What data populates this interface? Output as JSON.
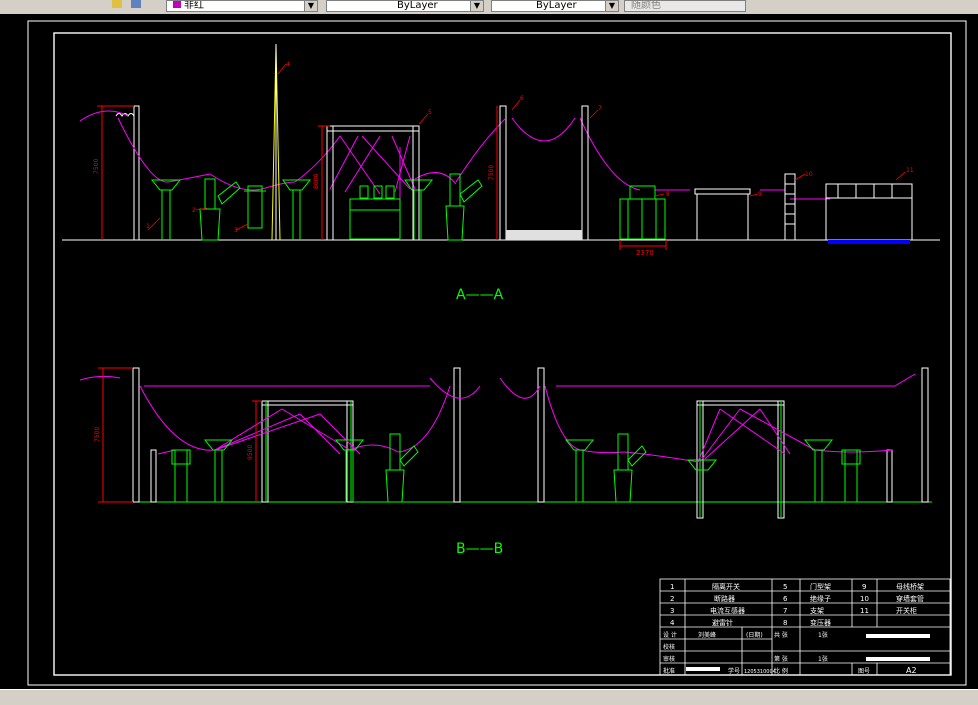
{
  "toolbar": {
    "layer_value": "非红",
    "linetype_value": "ByLayer",
    "lineweight_value": "ByLayer",
    "plotstyle_value": "随颜色"
  },
  "drawing": {
    "section_aa": "A——A",
    "section_bb": "B——B",
    "dims": {
      "aa_left_height": "7500",
      "aa_mid_height": "8000",
      "aa_right_height": "7500",
      "aa_bottom_width": "2370",
      "bb_left_height": "7500",
      "bb_mid_height": "9500"
    },
    "callouts": [
      "1",
      "2",
      "3",
      "4",
      "5",
      "6",
      "7",
      "8",
      "9",
      "10",
      "11"
    ]
  },
  "legend": {
    "rows": [
      {
        "n1": "1",
        "t1": "隔离开关",
        "n2": "5",
        "t2": "门型架",
        "n3": "9",
        "t3": "母线桥架"
      },
      {
        "n1": "2",
        "t1": "断路器",
        "n2": "6",
        "t2": "绝缘子",
        "n3": "10",
        "t3": "穿墙套管"
      },
      {
        "n1": "3",
        "t1": "电流互感器",
        "n2": "7",
        "t2": "支架",
        "n3": "11",
        "t3": "开关柜"
      },
      {
        "n1": "4",
        "t1": "避雷针",
        "n2": "8",
        "t2": "变压器",
        "n3": "",
        "t3": ""
      }
    ]
  },
  "titleblock": {
    "design_label": "设 计",
    "designer": "刘美峰",
    "date_label": "(日期)",
    "check_label": "校核",
    "review_label": "审核",
    "approve_label": "批准",
    "sheet_label": "共 张",
    "sheet_value": "1张",
    "sheet_no_label": "第 张",
    "sheet_no_value": "1张",
    "ratio_label": "比 例",
    "student_label": "学号",
    "student_no": "1205310004",
    "drawing_no_label": "图号",
    "size": "A2"
  },
  "colors": {
    "structure": "#ffffff",
    "equipment": "#00ff00",
    "conductor": "#ff00ff",
    "dimension": "#ff0000",
    "label": "#00ff00",
    "blue": "#0000ff"
  }
}
